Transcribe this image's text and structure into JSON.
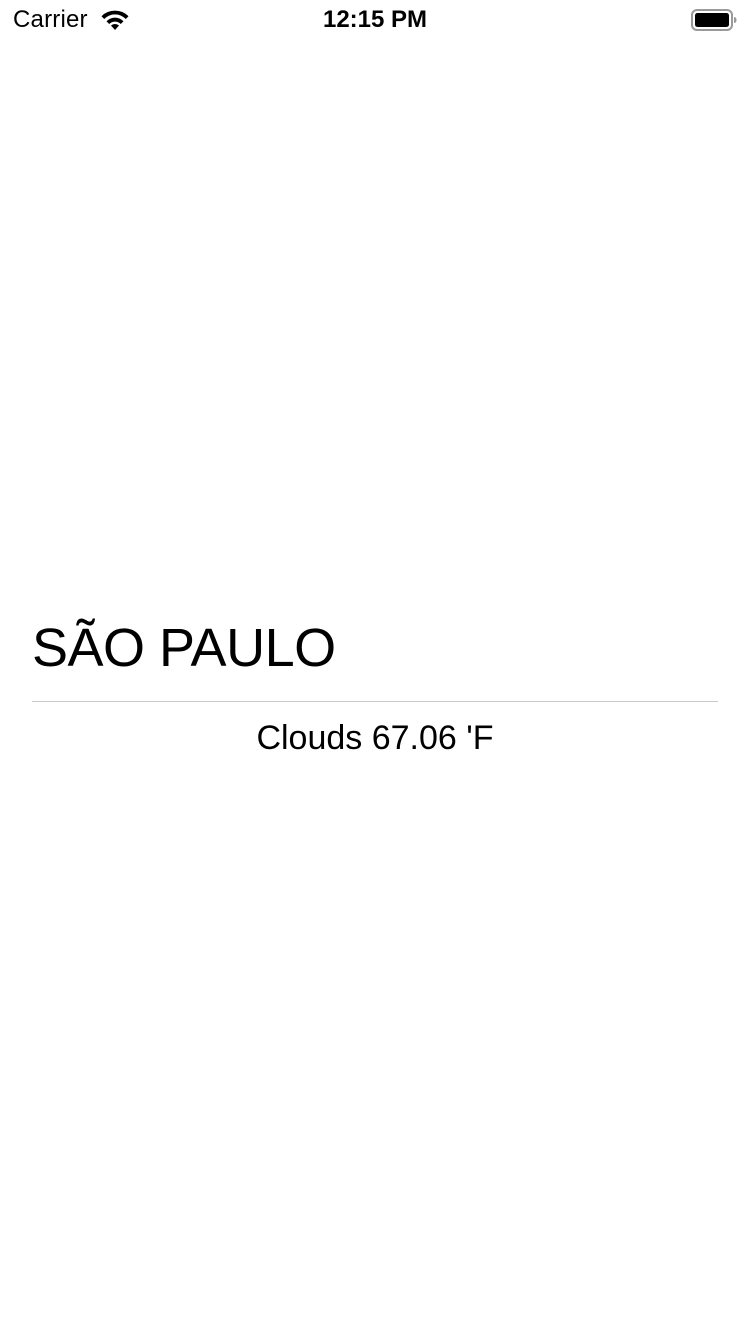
{
  "status_bar": {
    "carrier": "Carrier",
    "time": "12:15 PM",
    "wifi_icon": "wifi-icon",
    "battery_icon": "battery-full-icon"
  },
  "weather": {
    "city": "SÃO PAULO",
    "summary": "Clouds 67.06 'F"
  },
  "colors": {
    "background": "#ffffff",
    "text": "#000000",
    "divider": "#c8c8cc"
  }
}
